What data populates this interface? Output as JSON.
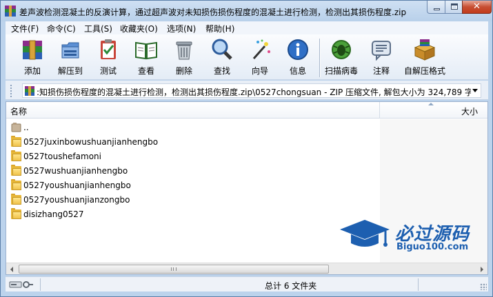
{
  "window": {
    "title": "差声波检测混凝土的反演计算，通过超声波对未知损伤损伤程度的混凝土进行检测，检测出其损伤程度.zip",
    "accent_close": "#c23a1a"
  },
  "menu": [
    "文件(F)",
    "命令(C)",
    "工具(S)",
    "收藏夹(O)",
    "选项(N)",
    "帮助(H)"
  ],
  "toolbar": {
    "buttons": [
      {
        "label": "添加",
        "icon": "add-archive-icon"
      },
      {
        "label": "解压到",
        "icon": "extract-to-icon"
      },
      {
        "label": "测试",
        "icon": "test-archive-icon"
      },
      {
        "label": "查看",
        "icon": "view-book-icon"
      },
      {
        "label": "删除",
        "icon": "delete-trash-icon"
      },
      {
        "label": "查找",
        "icon": "find-magnifier-icon"
      },
      {
        "label": "向导",
        "icon": "wizard-wand-icon"
      },
      {
        "label": "信息",
        "icon": "info-icon"
      },
      {
        "label": "扫描病毒",
        "icon": "virus-scan-icon"
      },
      {
        "label": "注释",
        "icon": "comment-icon"
      },
      {
        "label": "自解压格式",
        "icon": "sfx-box-icon"
      }
    ]
  },
  "address": {
    "path": ":知损伤损伤程度的混凝土进行检测，检测出其损伤程度.zip\\0527chongsuan - ZIP 压缩文件, 解包大小为 324,789 字节"
  },
  "list": {
    "columns": {
      "name": "名称",
      "size": "大小"
    },
    "rows": [
      {
        "name": "..",
        "type": "parent"
      },
      {
        "name": "0527juxinbowushuanjianhengbo",
        "type": "folder"
      },
      {
        "name": "0527toushefamoni",
        "type": "folder"
      },
      {
        "name": "0527wushuanjianhengbo",
        "type": "folder"
      },
      {
        "name": "0527youshuanjianhengbo",
        "type": "folder"
      },
      {
        "name": "0527youshuanjianzongbo",
        "type": "folder"
      },
      {
        "name": "disizhang0527",
        "type": "folder"
      }
    ]
  },
  "watermark": {
    "title": "必过源码",
    "url": "Biguo100.com",
    "color": "#1d5fb0"
  },
  "status": {
    "text": "总计 6 文件夹"
  }
}
